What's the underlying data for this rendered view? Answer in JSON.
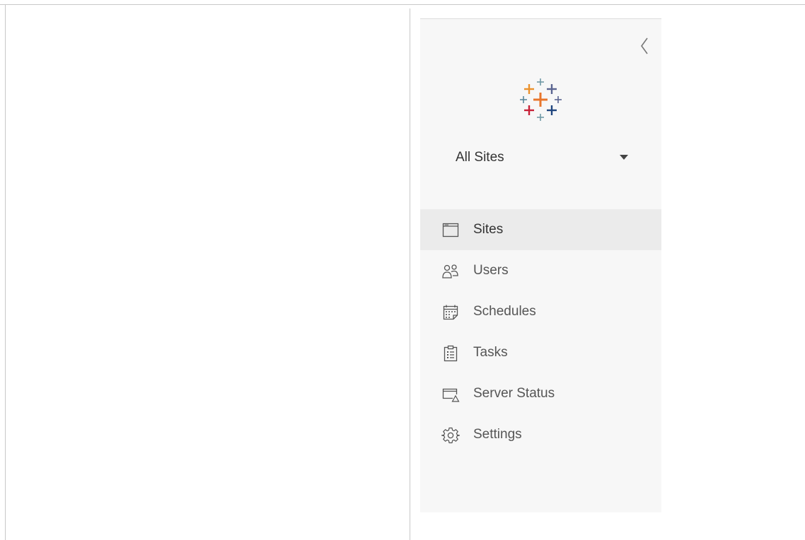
{
  "sidebar": {
    "collapse_icon": "chevron-left-icon",
    "logo": "tableau-logo",
    "site_selector": {
      "value": "All Sites",
      "caret_icon": "caret-down-icon"
    },
    "items": [
      {
        "label": "Sites",
        "icon": "sites-icon",
        "selected": true
      },
      {
        "label": "Users",
        "icon": "users-icon",
        "selected": false
      },
      {
        "label": "Schedules",
        "icon": "schedules-icon",
        "selected": false
      },
      {
        "label": "Tasks",
        "icon": "tasks-icon",
        "selected": false
      },
      {
        "label": "Server Status",
        "icon": "server-status-icon",
        "selected": false
      },
      {
        "label": "Settings",
        "icon": "settings-icon",
        "selected": false
      }
    ]
  },
  "colors": {
    "panel_background": "#f7f7f7",
    "selected_item_background": "#ebebeb",
    "text": "#555555",
    "logo_orange": "#e8762c",
    "logo_blue": "#5b6591",
    "logo_red": "#c72037",
    "logo_navy": "#1f457e",
    "logo_teal": "#59879b"
  }
}
